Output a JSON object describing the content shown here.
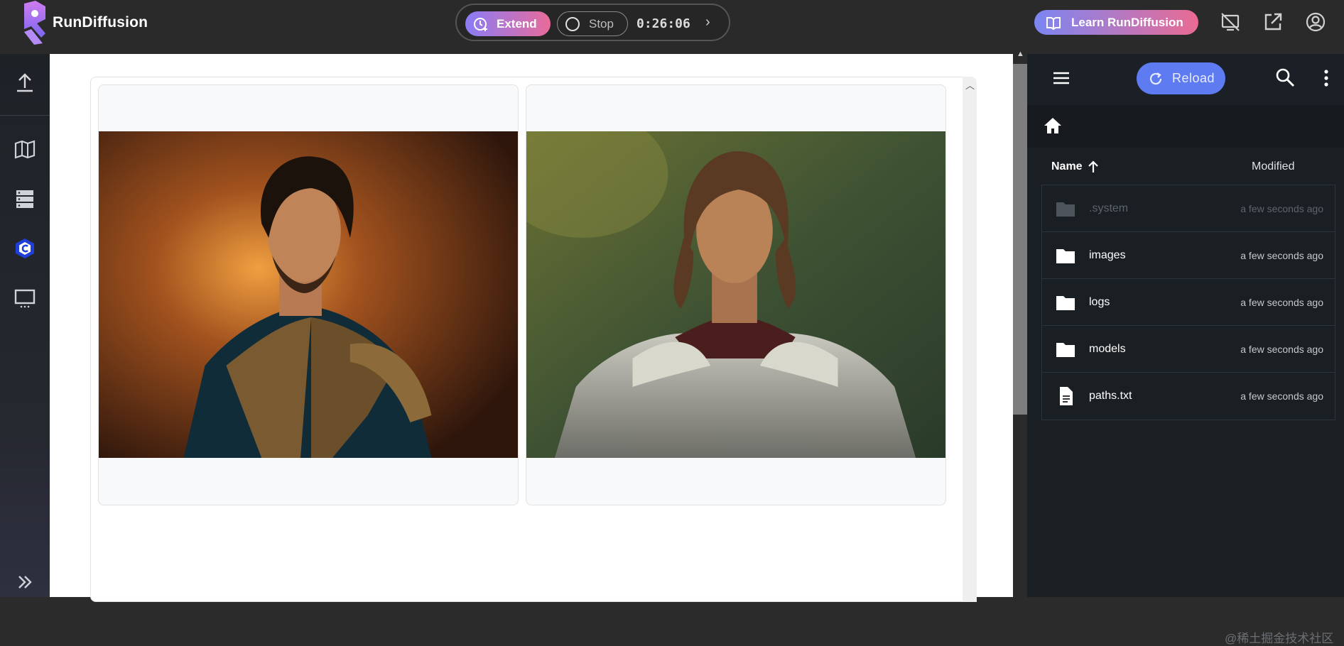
{
  "app": {
    "name": "RunDiffusion"
  },
  "session": {
    "extend_label": "Extend",
    "stop_label": "Stop",
    "timer": "0:26:06"
  },
  "header": {
    "learn_label": "Learn RunDiffusion"
  },
  "file_manager": {
    "reload_label": "Reload",
    "columns": {
      "name": "Name",
      "modified": "Modified"
    },
    "files": [
      {
        "name": ".system",
        "modified": "a few seconds ago",
        "type": "folder"
      },
      {
        "name": "images",
        "modified": "a few seconds ago",
        "type": "folder"
      },
      {
        "name": "logs",
        "modified": "a few seconds ago",
        "type": "folder"
      },
      {
        "name": "models",
        "modified": "a few seconds ago",
        "type": "folder"
      },
      {
        "name": "paths.txt",
        "modified": "a few seconds ago",
        "type": "file"
      }
    ]
  },
  "watermark": "@稀土掘金技术社区",
  "colors": {
    "accent": "#5e7bf2",
    "gradient_start": "#8a7cf6",
    "gradient_end": "#e86b9a"
  }
}
